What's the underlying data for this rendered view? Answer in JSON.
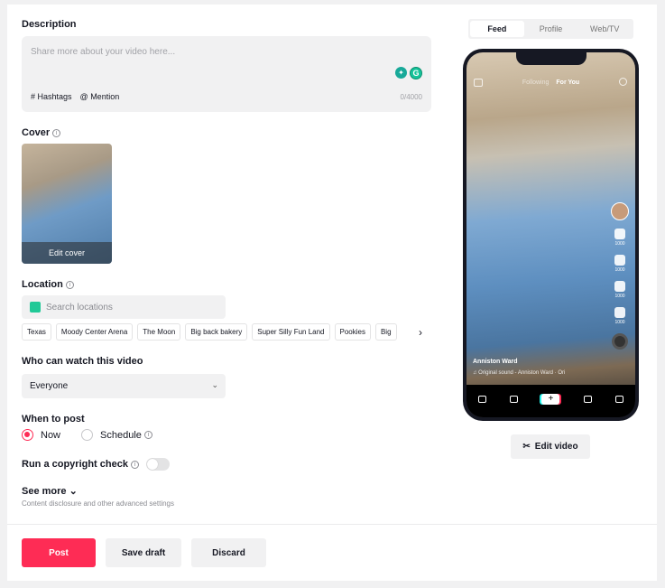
{
  "description": {
    "label": "Description",
    "placeholder": "Share more about your video here...",
    "hashtags": "Hashtags",
    "mention": "Mention",
    "count": "0/4000"
  },
  "cover": {
    "label": "Cover",
    "edit_label": "Edit cover"
  },
  "location": {
    "label": "Location",
    "placeholder": "Search locations",
    "suggestions": [
      "Texas",
      "Moody Center Arena",
      "The Moon",
      "Big back bakery",
      "Super Silly Fun Land",
      "Pookies",
      "Big"
    ]
  },
  "privacy": {
    "label": "Who can watch this video",
    "value": "Everyone"
  },
  "schedule": {
    "label": "When to post",
    "now": "Now",
    "schedule": "Schedule",
    "selected": "Now"
  },
  "copyright": {
    "label": "Run a copyright check",
    "enabled": false
  },
  "advanced": {
    "label": "See more",
    "sub": "Content disclosure and other advanced settings"
  },
  "actions": {
    "post": "Post",
    "save_draft": "Save draft",
    "discard": "Discard"
  },
  "preview": {
    "tabs": [
      "Feed",
      "Profile",
      "Web/TV"
    ],
    "active_tab": "Feed",
    "top_following": "Following",
    "top_foryou": "For You",
    "counts": [
      "1000",
      "1000",
      "1000",
      "1000"
    ],
    "username": "Anniston Ward",
    "sound": "Original sound - Anniston Ward",
    "sound_extra": "Ori",
    "edit_video": "Edit video"
  },
  "colors": {
    "accent": "#fe2c55",
    "field_bg": "#f1f1f2"
  }
}
